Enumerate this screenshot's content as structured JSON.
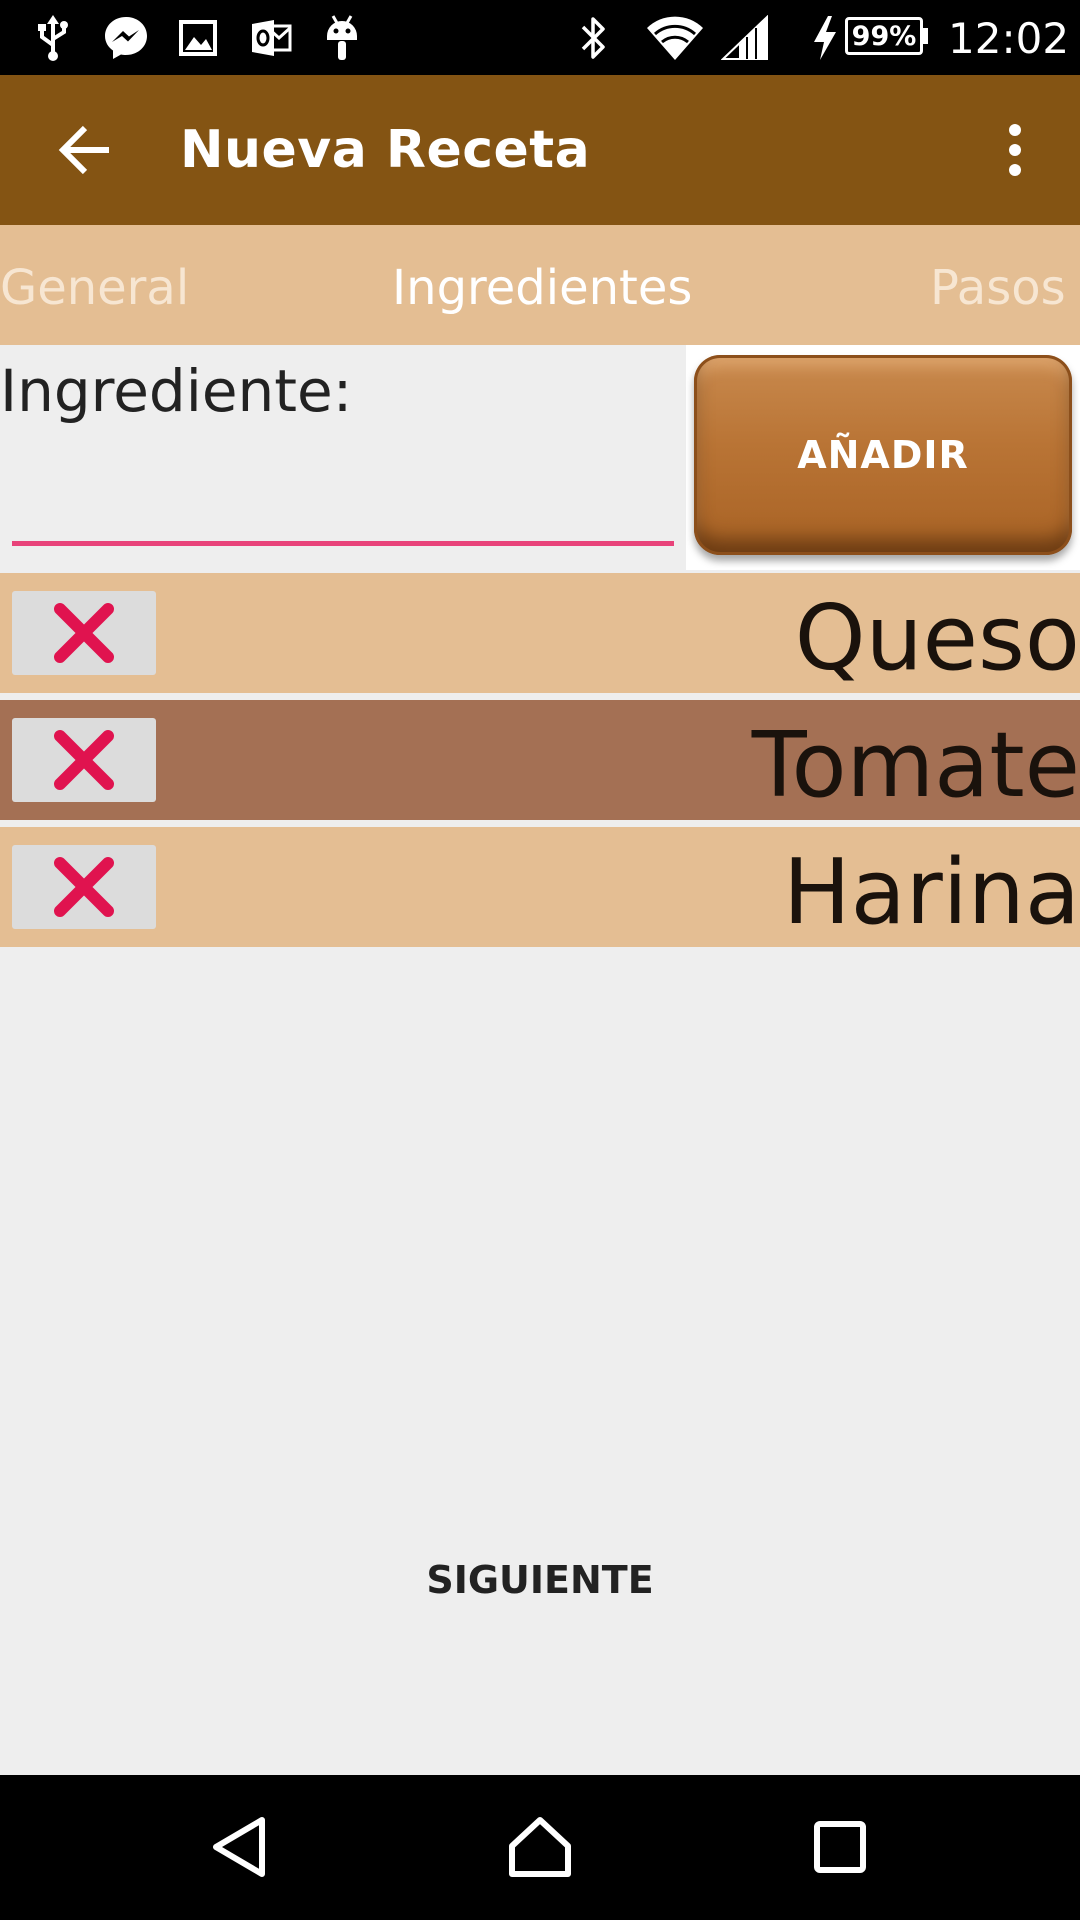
{
  "status_bar": {
    "time": "12:02",
    "battery": "99%",
    "left_icons": [
      "usb-icon",
      "messenger-icon",
      "gallery-icon",
      "outlook-icon",
      "android-debug-icon"
    ],
    "right_icons": [
      "bluetooth-icon",
      "wifi-icon",
      "signal-icon",
      "charging-icon"
    ]
  },
  "app_bar": {
    "title": "Nueva Receta",
    "back_icon": "arrow-back-icon",
    "overflow_icon": "more-vert-icon",
    "background": "#845413"
  },
  "tabs": [
    {
      "label": "General",
      "selected": false
    },
    {
      "label": "Ingredientes",
      "selected": true
    },
    {
      "label": "Pasos",
      "selected": false
    }
  ],
  "form": {
    "ingredient_label": "Ingrediente:",
    "ingredient_value": "",
    "add_button_label": "AÑADIR",
    "underline_color": "#e8437a"
  },
  "ingredients": [
    {
      "name": "Queso",
      "remove_icon": "delete-x-icon"
    },
    {
      "name": "Tomate",
      "remove_icon": "delete-x-icon"
    },
    {
      "name": "Harina",
      "remove_icon": "delete-x-icon"
    }
  ],
  "next_button_label": "SIGUIENTE",
  "nav_bar": {
    "icons": [
      "nav-back-icon",
      "nav-home-icon",
      "nav-recents-icon"
    ]
  },
  "colors": {
    "tab_bg": "#e4be93",
    "row_light": "#e4be93",
    "row_dark": "#a47054",
    "delete_x": "#e0134f"
  }
}
